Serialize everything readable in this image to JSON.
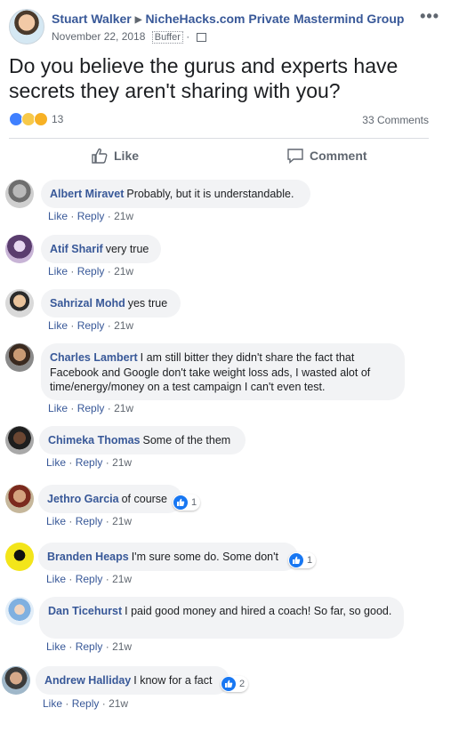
{
  "post": {
    "author": "Stuart Walker",
    "group": "NicheHacks.com Private Mastermind Group",
    "date": "November 22, 2018",
    "via": "Buffer",
    "text": "Do you believe the gurus and experts have secrets they aren't sharing with you?",
    "reaction_count": "13",
    "reaction_icons": [
      "like-reaction-icon",
      "haha-reaction-icon",
      "wow-reaction-icon"
    ],
    "comments_count": "33 Comments"
  },
  "actions": {
    "like": "Like",
    "comment": "Comment"
  },
  "comment_actions": {
    "like": "Like",
    "reply": "Reply",
    "sep": "·"
  },
  "colors": {
    "link": "#385898",
    "bubble": "#f2f3f5",
    "like_blue": "#1877f2"
  },
  "comments": [
    {
      "name": "Albert Miravet",
      "text": "Probably, but it is understandable.",
      "time": "21w",
      "likes": ""
    },
    {
      "name": "Atif Sharif",
      "text": "very true",
      "time": "21w",
      "likes": ""
    },
    {
      "name": "Sahrizal Mohd",
      "text": "yes true",
      "time": "21w",
      "likes": ""
    },
    {
      "name": "Charles Lambert",
      "text": "I am still bitter they didn't share the fact that Facebook and Google don't take weight loss ads, I wasted alot of time/energy/money on a test campaign I can't even test.",
      "time": "21w",
      "likes": ""
    },
    {
      "name": "Chimeka Thomas",
      "text": "Some of the them",
      "time": "21w",
      "likes": ""
    },
    {
      "name": "Jethro Garcia",
      "text": "of course",
      "time": "21w",
      "likes": "1"
    },
    {
      "name": "Branden Heaps",
      "text": "I'm sure some do. Some don't",
      "time": "21w",
      "likes": "1"
    },
    {
      "name": "Dan Ticehurst",
      "text": "I paid good money and hired a coach! So far, so good.",
      "time": "21w",
      "likes": ""
    },
    {
      "name": "Andrew Halliday",
      "text": "I know for a fact",
      "time": "21w",
      "likes": "2"
    }
  ]
}
